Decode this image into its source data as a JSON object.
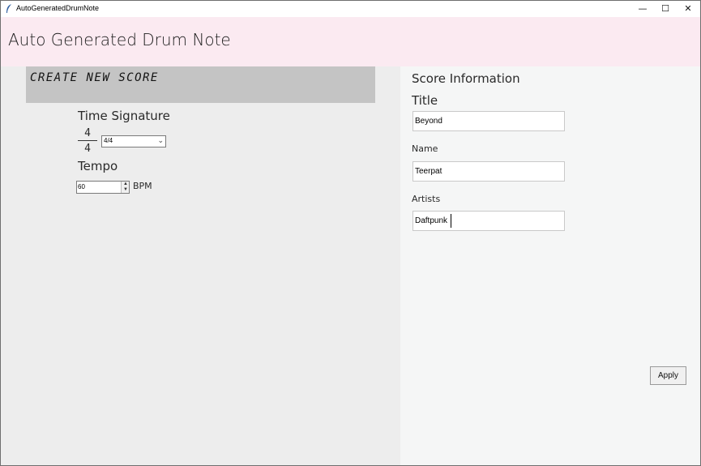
{
  "window": {
    "title": "AutoGeneratedDrumNote",
    "controls": {
      "minimize": "—",
      "maximize": "☐",
      "close": "✕"
    },
    "icon": "feather-icon"
  },
  "header": {
    "title": "Auto Generated Drum Note"
  },
  "left_panel": {
    "banner": "CREATE NEW SCORE",
    "time_signature": {
      "label": "Time Signature",
      "numerator": "4",
      "denominator": "4",
      "selected": "4/4"
    },
    "tempo": {
      "label": "Tempo",
      "value": "60",
      "unit": "BPM"
    }
  },
  "score_info": {
    "heading": "Score Information",
    "title_label": "Title",
    "title_value": "Beyond",
    "name_label": "Name",
    "name_value": "Teerpat",
    "artists_label": "Artists",
    "artists_value": "Daftpunk",
    "apply_label": "Apply"
  },
  "colors": {
    "header_bg": "#fbeaf1",
    "banner_bg": "#c4c4c4",
    "left_bg": "#ededed",
    "right_bg": "#f5f6f6"
  }
}
